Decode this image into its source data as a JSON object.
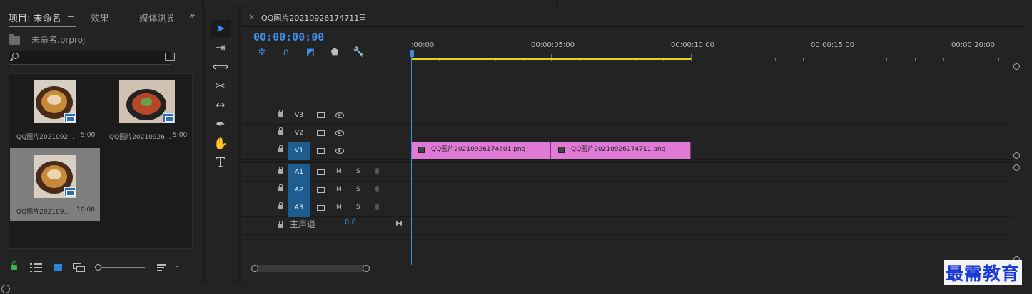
{
  "project_panel": {
    "tabs": [
      {
        "label": "项目: 未命名",
        "active": true
      },
      {
        "label": "效果",
        "active": false
      },
      {
        "label": "媒体浏览",
        "active": false
      }
    ],
    "project_file": "未命名.prproj",
    "search_placeholder": "",
    "items": [
      {
        "name": "QQ图片2021092...",
        "duration": "5:00",
        "selected": false
      },
      {
        "name": "QQ图片20210926...",
        "duration": "5:00",
        "selected": false
      },
      {
        "name": "QQ图片202109...",
        "duration": "10:00",
        "selected": true
      }
    ]
  },
  "tools": [
    "selection-tool",
    "track-select-tool",
    "ripple-edit-tool",
    "razor-tool",
    "slip-tool",
    "pen-tool",
    "hand-tool",
    "type-tool"
  ],
  "timeline": {
    "sequence_name": "QQ图片20210926174711",
    "timecode": "00:00:00:00",
    "ruler_labels": [
      ":00:00",
      "00:00:05:00",
      "00:00:10:00",
      "00:00:15:00",
      "00:00:20:00"
    ],
    "video_tracks": [
      "V3",
      "V2",
      "V1"
    ],
    "audio_tracks": [
      "A1",
      "A2",
      "A3"
    ],
    "mute_label": "M",
    "solo_label": "S",
    "master": {
      "label": "主声道",
      "value": "0.0"
    },
    "clips": [
      {
        "name": "QQ图片20210926174601.png",
        "track": "V1"
      },
      {
        "name": "QQ图片20210926174711.png",
        "track": "V1"
      }
    ]
  },
  "watermark": "最需教育",
  "colors": {
    "accent_blue": "#3d8ee6",
    "clip_pink": "#e07ad6",
    "work_area_yellow": "#e5d51a",
    "lock_green": "#3db54a"
  }
}
